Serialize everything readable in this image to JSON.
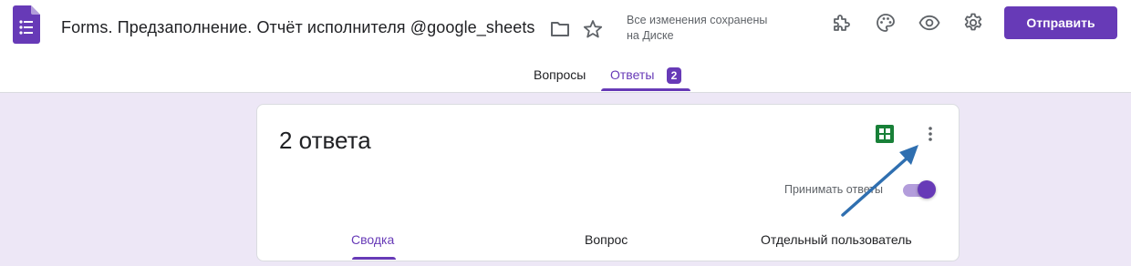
{
  "header": {
    "title": "Forms. Предзаполнение.  Отчёт исполнителя  @google_sheets",
    "saved_status_line1": "Все изменения сохранены",
    "saved_status_line2": "на Диске",
    "send_label": "Отправить",
    "icons": [
      "folder-icon",
      "star-icon",
      "addons-icon",
      "palette-icon",
      "preview-icon",
      "settings-icon"
    ]
  },
  "tabs": [
    {
      "label": "Вопросы"
    },
    {
      "label": "Ответы",
      "badge": "2",
      "active": true
    }
  ],
  "responses": {
    "count_title": "2 ответа",
    "accept_label": "Принимать ответы",
    "accepting": true,
    "subtabs": [
      {
        "label": "Сводка",
        "active": true
      },
      {
        "label": "Вопрос"
      },
      {
        "label": "Отдельный пользователь"
      }
    ]
  },
  "colors": {
    "accent": "#673ab7",
    "background": "#ede7f6",
    "sheets_green": "#188038",
    "annotation_arrow": "#2f6fb0"
  }
}
